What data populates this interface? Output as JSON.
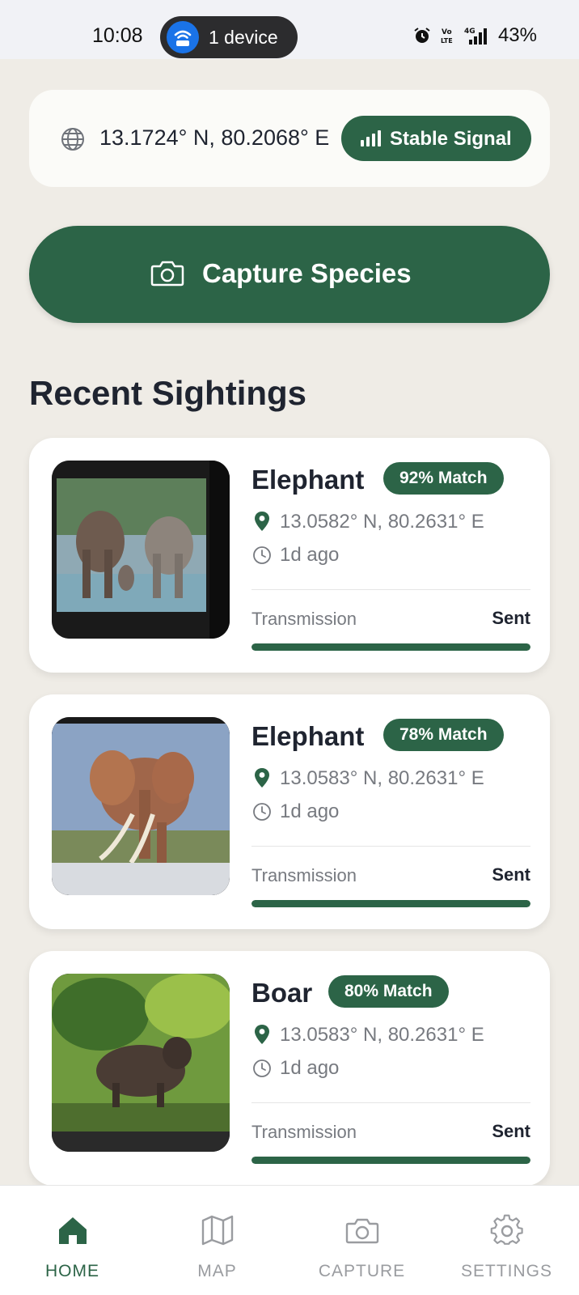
{
  "status_bar": {
    "time": "10:08",
    "device_pill": "1 device",
    "network": "4G",
    "battery": "43%"
  },
  "location": {
    "coords": "13.1724° N, 80.2068° E",
    "signal_label": "Stable Signal",
    "icon": "globe-icon"
  },
  "capture": {
    "label": "Capture Species",
    "icon": "camera-icon"
  },
  "section_title": "Recent Sightings",
  "sightings": [
    {
      "species": "Elephant",
      "match": "92% Match",
      "coords": "13.0582° N, 80.2631° E",
      "ago": "1d ago",
      "transmission_label": "Transmission",
      "transmission_status": "Sent",
      "progress": 1.0
    },
    {
      "species": "Elephant",
      "match": "78% Match",
      "coords": "13.0583° N, 80.2631° E",
      "ago": "1d ago",
      "transmission_label": "Transmission",
      "transmission_status": "Sent",
      "progress": 1.0
    },
    {
      "species": "Boar",
      "match": "80% Match",
      "coords": "13.0583° N, 80.2631° E",
      "ago": "1d ago",
      "transmission_label": "Transmission",
      "transmission_status": "Sent",
      "progress": 1.0
    }
  ],
  "nav": {
    "items": [
      {
        "label": "HOME",
        "icon": "home-icon",
        "active": true
      },
      {
        "label": "MAP",
        "icon": "map-icon",
        "active": false
      },
      {
        "label": "CAPTURE",
        "icon": "camera-icon",
        "active": false
      },
      {
        "label": "SETTINGS",
        "icon": "gear-icon",
        "active": false
      }
    ]
  },
  "colors": {
    "accent": "#2c6447",
    "background": "#efece6",
    "muted_text": "#777a80"
  }
}
